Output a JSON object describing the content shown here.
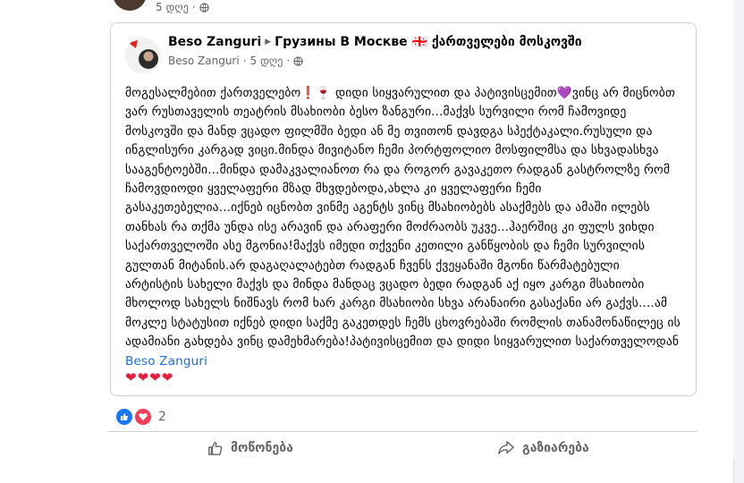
{
  "top_post": {
    "time": "5 დღე",
    "privacy_icon": "globe-icon"
  },
  "shared_post": {
    "author": "Beso Zanguri",
    "group": "Грузины В Москве 🇬🇪 ქართველები მოსკოვში",
    "sub_author": "Beso Zanguri",
    "time": "5 დღე",
    "privacy_icon": "globe-icon",
    "paragraph_1": "მოგესალმებით ქართველებო❗🍷 დიდი სიყვარულით და პატივისცემით💜ვინც არ მიცნობთ ვარ რუსთაველის თეატრის მსახიობი ბესო ზანგური...მაქვს სურვილი რომ ჩამოვიდე მოსკოვში და მანდ ვცადო ფილმში ბედი ან მე თვითონ დავდგა სპექტაკალი.რუსული და ინგლისური კარგად ვიცი.მინდა მივიტანო ჩემი პორტფოლიო მოსფილმსა და სხვადასხვა სააგენტოებში...მინდა დამაკვალიანოთ რა და როგორ გავაკეთო რადგან გასტროლზე რომ ჩამოვდიოდი ყველაფერი მზად მხვდებოდა,ახლა კი ყველაფერი ჩემი გასაკეთებელია...იქნებ იცნობთ ვინმე აგენტს ვინც მსახიობებს ასაქმებს და ამაში ილებს თანხას რა თქმა უნდა ისე არავინ და არაფერი მოძრაობს უკვე...ჰაერშიც კი ფულს ვიხდი საქართველოში ასე მგონია!მაქვს იმედი თქვენი კეთილი განწყობის და ჩემი სურვილის გულთან მიტანის.არ დაგაღალატებთ რადგან ჩვენს ქვეყანაში მგონი წარმატებული არტისტის სახელი მაქვს და მინდა მანდაც ვცადო ბედი რადგან აქ იყო კარგი მსახიობი მხოლოდ სახელს ნიშნავს რომ ხარ კარგი მსახიობი სხვა არანაირი გასაქანი არ გაქვს....ამ მოკლე სტატუსით იქნებ დიდი საქმე გაკეთდეს ჩემს ცხოვრებაში რომლის თანამონაწილეც ის ადამიანი გახდება ვინც დამეხმარება!პატივისცემით და დიდი სიყვარულით საქართველოდან ",
    "hashtag": "Beso Zanguri",
    "hearts": "❤❤❤❤"
  },
  "reactions": {
    "count": "2",
    "icons": [
      "like-reaction-icon",
      "love-reaction-icon"
    ]
  },
  "actions": {
    "like_label": "მოწონება",
    "share_label": "გაზიარება"
  },
  "colors": {
    "link": "#216fdb",
    "like_blue": "#1877f2",
    "love_red": "#f33e58",
    "muted": "#65676b"
  }
}
